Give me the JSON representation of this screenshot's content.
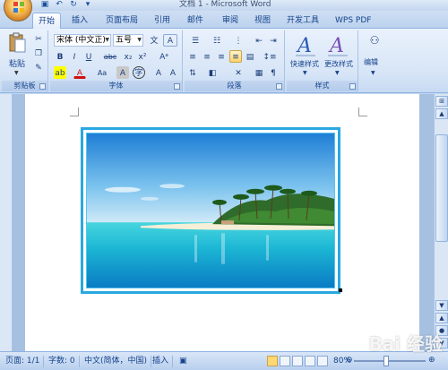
{
  "window": {
    "title": "文档 1 - Microsoft Word"
  },
  "tabs": [
    {
      "label": "开始",
      "active": true
    },
    {
      "label": "插入",
      "active": false
    },
    {
      "label": "页面布局",
      "active": false
    },
    {
      "label": "引用",
      "active": false
    },
    {
      "label": "邮件",
      "active": false
    },
    {
      "label": "审阅",
      "active": false
    },
    {
      "label": "视图",
      "active": false
    },
    {
      "label": "开发工具",
      "active": false
    },
    {
      "label": "WPS PDF",
      "active": false
    }
  ],
  "ribbon": {
    "clipboard": {
      "label": "剪贴板",
      "paste_label": "粘贴"
    },
    "font": {
      "label": "字体",
      "font_name": "宋体 (中文正)",
      "font_size": "五号",
      "bold": "B",
      "italic": "I",
      "underline": "U",
      "strikethrough": "abc",
      "subscript": "x₂",
      "superscript": "x²",
      "font_color": "A",
      "change_case": "Aa",
      "char_shading": "A",
      "enclose": "字",
      "clear_format": "A",
      "grow": "A",
      "phonetic": "文"
    },
    "paragraph": {
      "label": "段落"
    },
    "styles": {
      "label": "样式",
      "quick_styles": "快速样式",
      "change_styles": "更改样式"
    },
    "editing": {
      "label": "编辑",
      "find_icon_text": "A"
    }
  },
  "statusbar": {
    "page": "页面: 1/1",
    "words": "字数: 0",
    "language": "中文(简体，中国)",
    "insert_mode": "插入",
    "zoom": "80%"
  },
  "watermark": "Bai 经验",
  "colors": {
    "accent": "#15428b",
    "ribbon_bg": "#dbe7f7",
    "image_border": "#2aa8e0",
    "highlight": "#ffd36b"
  }
}
